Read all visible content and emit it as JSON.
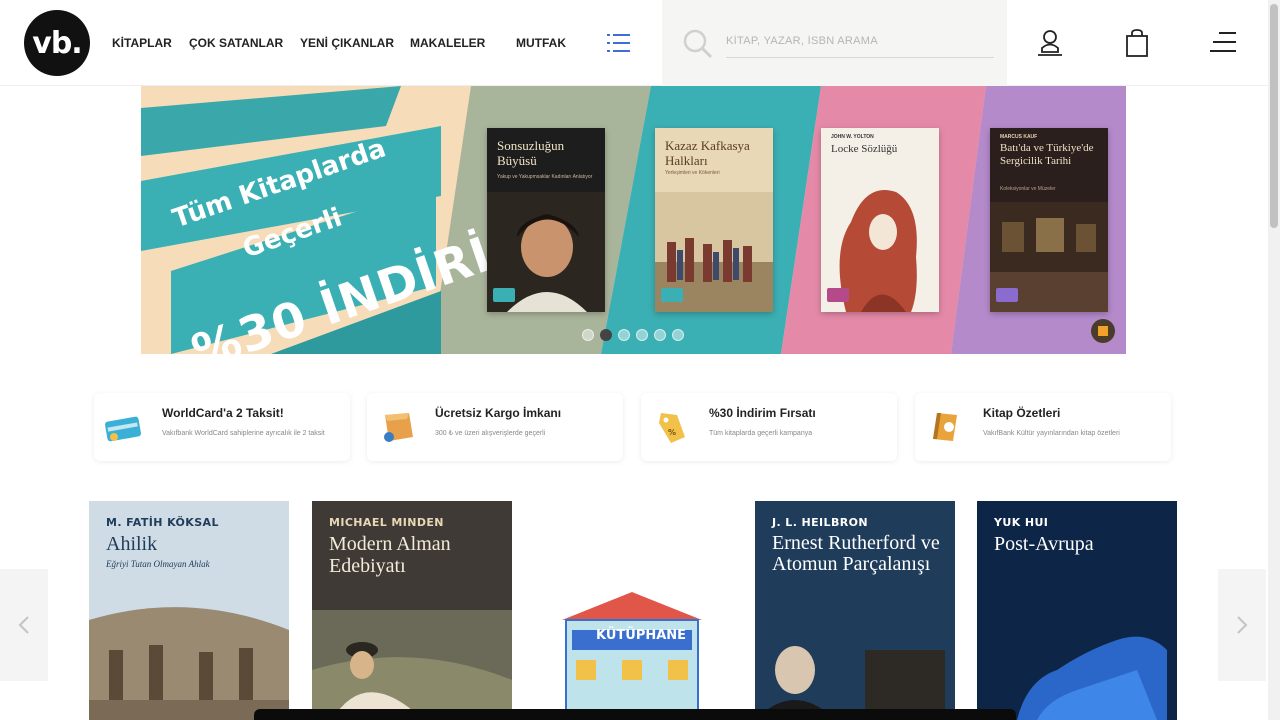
{
  "header": {
    "logo_text": "vb.",
    "nav": [
      "KİTAPLAR",
      "ÇOK SATANLAR",
      "YENİ ÇIKANLAR",
      "MAKALELER",
      "MUTFAK"
    ],
    "search_placeholder": "KİTAP, YAZAR, İSBN ARAMA",
    "icons": [
      "menu-list-icon",
      "search-icon",
      "user-icon",
      "shopping-bag-icon",
      "hamburger-menu-icon"
    ]
  },
  "banner": {
    "line1": "Tüm Kitaplarda",
    "line2": "Geçerli",
    "line3": "%30 İNDİRİM",
    "books": [
      {
        "title": "Sonsuzluğun Büyüsü",
        "subtitle": "Yakup ve Yakupmsaklar Kadınları Anlatıyor"
      },
      {
        "title": "Kazaz Kafkasya Halkları",
        "subtitle": "Yerleşimleri ve Kökenleri"
      },
      {
        "author": "JOHN W. YOLTON",
        "title": "Locke Sözlüğü"
      },
      {
        "author": "MARCUS KAUF",
        "title": "Batı'da ve Türkiye'de Sergicilik Tarihi",
        "subtitle": "Koleksiyonlar ve Müzeler"
      }
    ],
    "slide_count": 6,
    "active_slide": 2
  },
  "features": [
    {
      "title": "WorldCard'a 2 Taksit!",
      "desc": "Vakıfbank WorldCard sahiplerine ayrıcalık ile 2 taksit",
      "icon": "credit-card-icon"
    },
    {
      "title": "Ücretsiz Kargo İmkanı",
      "desc": "300 ₺ ve üzeri alışverişlerde geçerli",
      "icon": "cargo-box-icon"
    },
    {
      "title": "%30 İndirim Fırsatı",
      "desc": "Tüm kitaplarda geçerli kampanya",
      "icon": "discount-tag-icon"
    },
    {
      "title": "Kitap Özetleri",
      "desc": "VakıfBank Kültür yayınlarından kitap özetleri",
      "icon": "book-summary-icon"
    }
  ],
  "carousel": {
    "books": [
      {
        "author": "M. FATİH KÖKSAL",
        "title": "Ahilik",
        "subtitle": "Eğriyi Tutan Olmayan Ahlak"
      },
      {
        "author": "MICHAEL MINDEN",
        "title": "Modern Alman Edebiyatı",
        "subtitle": ""
      },
      {
        "author": "",
        "title": "KÜTÜPHANE",
        "subtitle": ""
      },
      {
        "author": "J. L. HEILBRON",
        "title": "Ernest Rutherford ve Atomun Parçalanışı",
        "subtitle": ""
      },
      {
        "author": "YUK HUI",
        "title": "Post-Avrupa",
        "subtitle": ""
      }
    ]
  },
  "colors": {
    "teal": "#3bb0b4",
    "peach": "#f6dcb8",
    "pink": "#e48aa8",
    "purple": "#b58acb",
    "navy": "#0d2547"
  }
}
